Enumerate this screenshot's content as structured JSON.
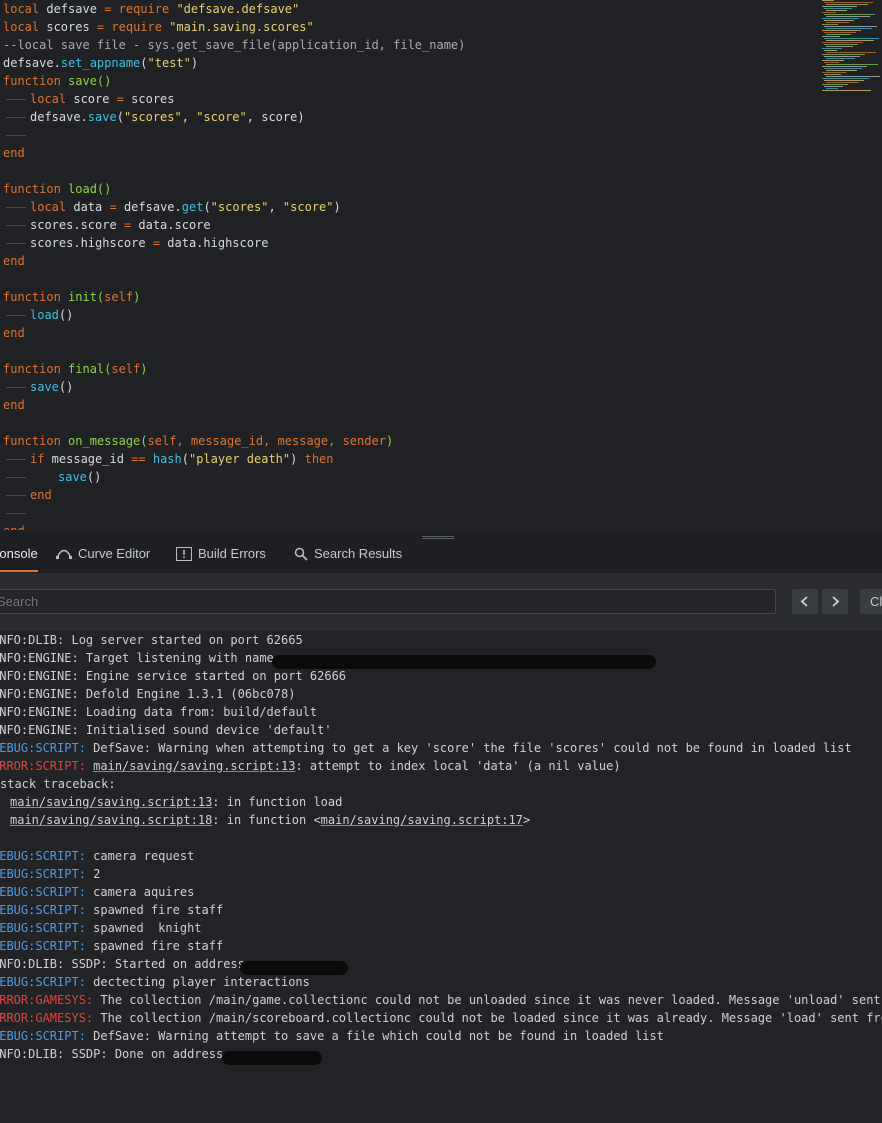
{
  "editor": {
    "lines": [
      {
        "type": "L1",
        "parts": [
          "local",
          "defsave",
          "=",
          "require",
          "\"defsave.defsave\""
        ]
      },
      {
        "type": "L2",
        "parts": [
          "local",
          "scores",
          "=",
          "require",
          "\"main.saving.scores\""
        ]
      },
      {
        "type": "comment",
        "text": "--local save file - sys.get_save_file(application_id, file_name)"
      },
      {
        "type": "call",
        "obj": "defsave.",
        "fn": "set_appname",
        "args": "(\"test\")"
      },
      {
        "type": "fndef",
        "name": "save",
        "params": "()"
      },
      {
        "type": "assign",
        "text": "local score = scores"
      },
      {
        "type": "callargs",
        "obj": "defsave.",
        "fn": "save",
        "args": "(\"scores\", \"score\", score)"
      },
      {
        "type": "blank"
      },
      {
        "type": "end"
      },
      {
        "type": "blank"
      },
      {
        "type": "fndef",
        "name": "load",
        "params": "()"
      },
      {
        "type": "assign2",
        "text": "local data = defsave.",
        "fn": "get",
        "args": "(\"scores\", \"score\")"
      },
      {
        "type": "plain",
        "text": "scores.score = data.score"
      },
      {
        "type": "plain",
        "text": "scores.highscore = data.highscore"
      },
      {
        "type": "end"
      },
      {
        "type": "blank"
      },
      {
        "type": "fndef",
        "name": "init",
        "params": "(self)"
      },
      {
        "type": "call1",
        "fn": "load",
        "args": "()"
      },
      {
        "type": "end"
      },
      {
        "type": "blank"
      },
      {
        "type": "fndef",
        "name": "final",
        "params": "(self)"
      },
      {
        "type": "call1",
        "fn": "save",
        "args": "()"
      },
      {
        "type": "end"
      },
      {
        "type": "blank"
      },
      {
        "type": "fndef",
        "name": "on_message",
        "params": "(self, message_id, message, sender)"
      },
      {
        "type": "if",
        "text": "if message_id == hash(\"player death\") then"
      },
      {
        "type": "call2",
        "fn": "save",
        "args": "()"
      },
      {
        "type": "end2"
      },
      {
        "type": "blank"
      },
      {
        "type": "end"
      }
    ]
  },
  "tabs": [
    {
      "label": "Console",
      "icon": "none"
    },
    {
      "label": "Curve Editor",
      "icon": "curve-icon"
    },
    {
      "label": "Build Errors",
      "icon": "warning-icon"
    },
    {
      "label": "Search Results",
      "icon": "search-icon"
    }
  ],
  "toolbar": {
    "search_placeholder": "Search",
    "clear_label": "Clear"
  },
  "console": {
    "entries": [
      {
        "level": "info",
        "prefix": "INFO:DLIB:",
        "text": " Log server started on port 62665"
      },
      {
        "level": "info",
        "prefix": "INFO:ENGINE:",
        "text": " Target listening with name:"
      },
      {
        "level": "info",
        "prefix": "INFO:ENGINE:",
        "text": " Engine service started on port 62666"
      },
      {
        "level": "info",
        "prefix": "INFO:ENGINE:",
        "text": " Defold Engine 1.3.1 (06bc078)"
      },
      {
        "level": "info",
        "prefix": "INFO:ENGINE:",
        "text": " Loading data from: build/default"
      },
      {
        "level": "info",
        "prefix": "INFO:ENGINE:",
        "text": " Initialised sound device 'default'"
      },
      {
        "level": "debug",
        "prefix": "DEBUG:SCRIPT:",
        "text": " DefSave: Warning when attempting to get a key 'score' the file 'scores' could not be found in loaded list"
      },
      {
        "level": "error",
        "prefix": "ERROR:SCRIPT:",
        "text": "",
        "link": "main/saving/saving.script:13",
        "tail": ": attempt to index local 'data' (a nil value)"
      },
      {
        "level": "plain",
        "prefix": "",
        "text": "stack traceback:"
      },
      {
        "level": "trace",
        "link": "main/saving/saving.script:13",
        "tail": ": in function load"
      },
      {
        "level": "trace2",
        "link": "main/saving/saving.script:18",
        "mid": ": in function <",
        "link2": "main/saving/saving.script:17",
        "tail": ">"
      },
      {
        "level": "blank"
      },
      {
        "level": "debug",
        "prefix": "DEBUG:SCRIPT:",
        "text": " camera request"
      },
      {
        "level": "debug",
        "prefix": "DEBUG:SCRIPT:",
        "text": " 2"
      },
      {
        "level": "debug",
        "prefix": "DEBUG:SCRIPT:",
        "text": " camera aquires"
      },
      {
        "level": "debug",
        "prefix": "DEBUG:SCRIPT:",
        "text": " spawned fire staff"
      },
      {
        "level": "debug",
        "prefix": "DEBUG:SCRIPT:",
        "text": " spawned  knight"
      },
      {
        "level": "debug",
        "prefix": "DEBUG:SCRIPT:",
        "text": " spawned fire staff"
      },
      {
        "level": "info",
        "prefix": "INFO:DLIB:",
        "text": " SSDP: Started on address"
      },
      {
        "level": "debug",
        "prefix": "DEBUG:SCRIPT:",
        "text": " dectecting player interactions"
      },
      {
        "level": "error",
        "prefix": "ERROR:GAMESYS:",
        "text": " The collection /main/game.collectionc could not be unloaded since it was never loaded. Message 'unload' sent from main:/loader#collectionproxy"
      },
      {
        "level": "error",
        "prefix": "ERROR:GAMESYS:",
        "text": " The collection /main/scoreboard.collectionc could not be loaded since it was already. Message 'load' sent from main:/loader#collectionproxy"
      },
      {
        "level": "debug",
        "prefix": "DEBUG:SCRIPT:",
        "text": " DefSave: Warning attempt to save a file which could not be found in loaded list"
      },
      {
        "level": "info",
        "prefix": "INFO:DLIB:",
        "text": " SSDP: Done on address"
      }
    ]
  }
}
